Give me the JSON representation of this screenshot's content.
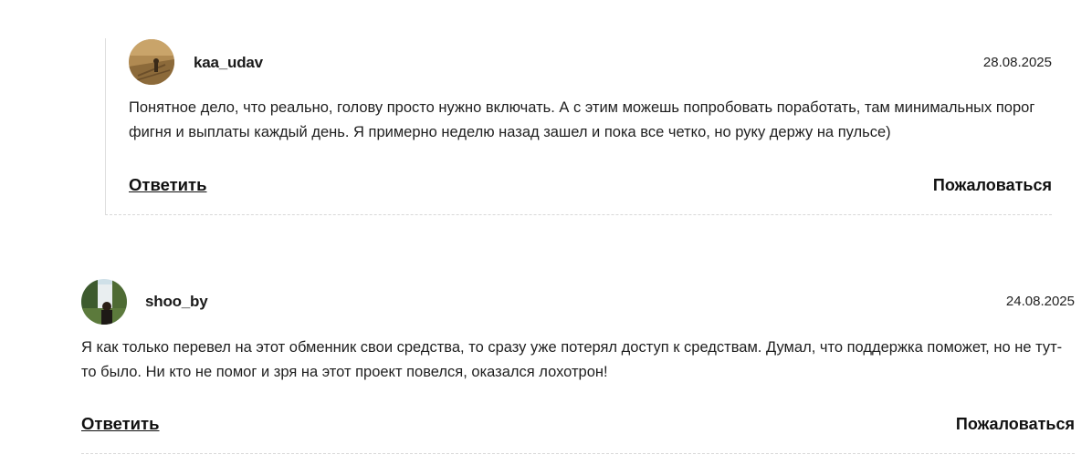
{
  "comments": [
    {
      "author": "kaa_udav",
      "date": "28.08.2025",
      "text": "Понятное дело, что реально, голову просто нужно включать. А с этим можешь попробовать поработать, там минимальных порог фигня и выплаты каждый день. Я примерно неделю назад зашел и пока все четко, но руку держу на пульсе)",
      "reply_label": "Ответить",
      "complain_label": "Пожаловаться"
    },
    {
      "author": "shoo_by",
      "date": "24.08.2025",
      "text": "Я как только перевел на этот обменник свои средства, то сразу уже потерял доступ к средствам. Думал, что поддержка поможет, но не тут-то было. Ни кто не помог и зря на этот проект повелся, оказался лохотрон!",
      "reply_label": "Ответить",
      "complain_label": "Пожаловаться"
    }
  ]
}
